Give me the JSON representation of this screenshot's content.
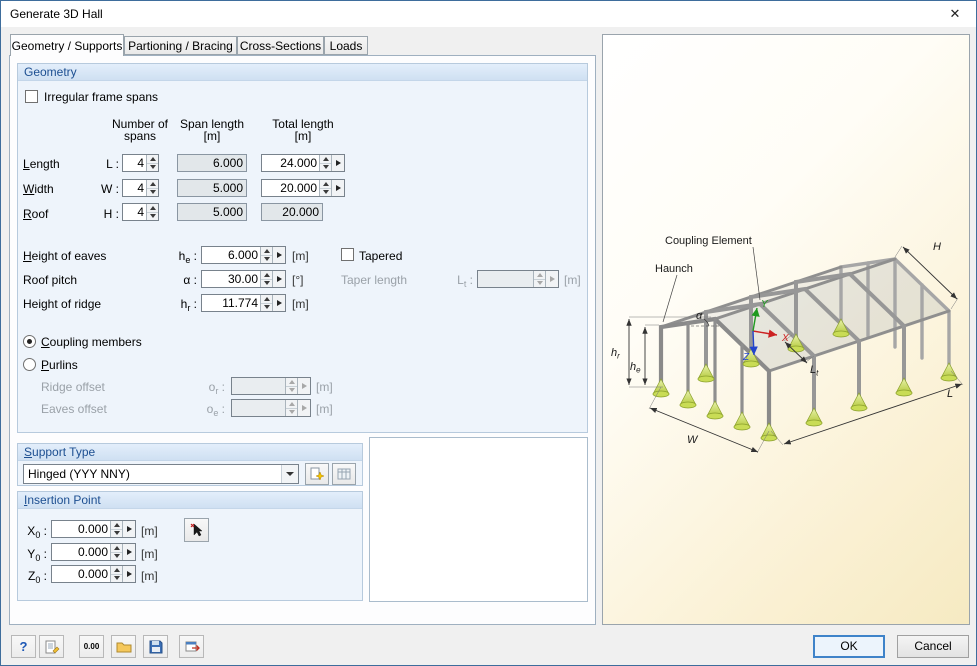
{
  "window": {
    "title": "Generate 3D Hall",
    "close_glyph": "✕"
  },
  "tabs": {
    "t1": "Geometry / Supports",
    "t2": "Partioning / Bracing",
    "t3": "Cross-Sections",
    "t4": "Loads"
  },
  "ui": {
    "colon": " :"
  },
  "geometry": {
    "title": "Geometry",
    "irregular": "Irregular frame spans",
    "col1a": "Number of",
    "col1b": "spans",
    "col2a": "Span length",
    "col2b": "[m]",
    "col3a": "Total length",
    "col3b": "[m]",
    "length": {
      "mn": "L",
      "rest": "ength",
      "sym": "L :",
      "spans": "4",
      "span_len": "6.000",
      "total": "24.000"
    },
    "width": {
      "mn": "W",
      "rest": "idth",
      "sym": "W :",
      "spans": "4",
      "span_len": "5.000",
      "total": "20.000"
    },
    "roof": {
      "mn": "R",
      "rest": "oof",
      "sym": "H :",
      "spans": "4",
      "span_len": "5.000",
      "total": "20.000"
    },
    "eaves": {
      "mn": "H",
      "rest": "eight of eaves",
      "sym_b": "h",
      "sym_s": "e",
      "value": "6.000",
      "unit": "[m]"
    },
    "pitch": {
      "label": "Roof pitch",
      "sym_b": "α",
      "sym_s": "",
      "value": "30.00",
      "unit": "[°]"
    },
    "ridge": {
      "label": "Height of ridge",
      "sym_b": "h",
      "sym_s": "r",
      "value": "11.774",
      "unit": "[m]"
    },
    "tapered": "Tapered",
    "taper": {
      "label": "Taper length",
      "sym_b": "L",
      "sym_s": "t",
      "value": "",
      "unit": "[m]"
    },
    "coupling": {
      "mn": "C",
      "rest": "oupling members"
    },
    "purlins": {
      "mn": "P",
      "rest": "urlins"
    },
    "ridge_offset": {
      "label": "Ridge offset",
      "sym_b": "o",
      "sym_s": "r",
      "value": "",
      "unit": "[m]"
    },
    "eaves_offset": {
      "label": "Eaves offset",
      "sym_b": "o",
      "sym_s": "e",
      "value": "",
      "unit": "[m]"
    }
  },
  "support": {
    "mn": "S",
    "rest": "upport Type",
    "value": "Hinged (YYY NNY)"
  },
  "insertion": {
    "mn": "I",
    "rest": "nsertion Point",
    "x": {
      "sym_b": "X",
      "sym_s": "0",
      "value": "0.000",
      "unit": "[m]"
    },
    "y": {
      "sym_b": "Y",
      "sym_s": "0",
      "value": "0.000",
      "unit": "[m]"
    },
    "z": {
      "sym_b": "Z",
      "sym_s": "0",
      "value": "0.000",
      "unit": "[m]"
    }
  },
  "preview": {
    "coupling_element": "Coupling Element",
    "haunch": "Haunch",
    "dim_h": "H",
    "dim_l": "L",
    "dim_w": "W",
    "hr_b": "h",
    "hr_s": "r",
    "he_b": "h",
    "he_s": "e",
    "lt_b": "L",
    "lt_s": "t",
    "alpha": "α",
    "axis_x": "X",
    "axis_y": "Y",
    "axis_z": "Z"
  },
  "footer": {
    "ok": "OK",
    "cancel": "Cancel",
    "units_label": "0.00"
  }
}
